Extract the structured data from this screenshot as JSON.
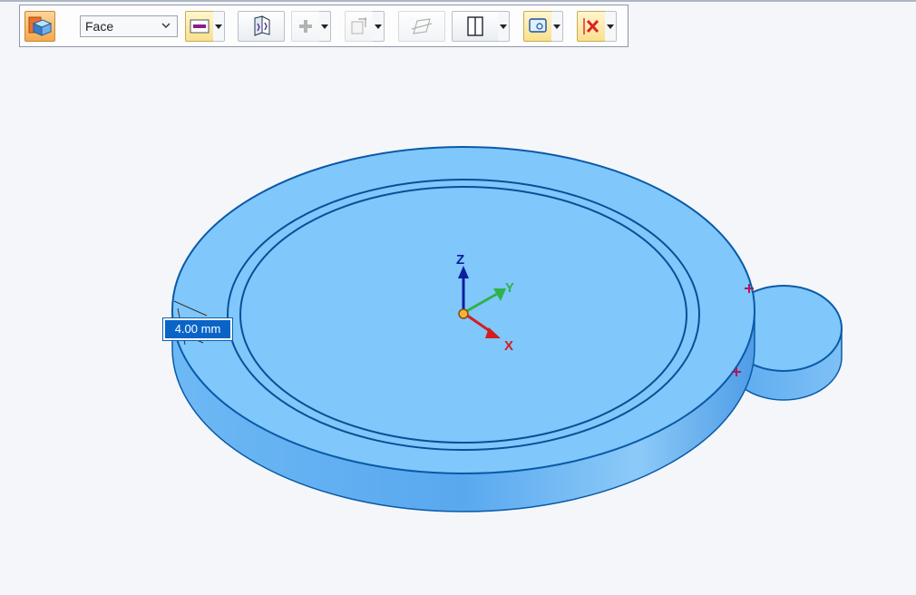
{
  "toolbar": {
    "selection_mode": "Face",
    "buttons": [
      {
        "name": "3d-view-button",
        "state": "active"
      },
      {
        "name": "color-swatch-button",
        "state": "normal"
      },
      {
        "name": "design-intent-button",
        "state": "normal"
      },
      {
        "name": "add-button",
        "state": "disabled"
      },
      {
        "name": "paste-button",
        "state": "disabled"
      },
      {
        "name": "plane-button",
        "state": "disabled"
      },
      {
        "name": "panel-button",
        "state": "normal"
      },
      {
        "name": "region-select-button",
        "state": "selected"
      },
      {
        "name": "delete-button",
        "state": "selected"
      }
    ]
  },
  "viewport": {
    "dimension_value": "4.00 mm",
    "axes": {
      "z": "Z",
      "y": "Y",
      "x": "X"
    },
    "colors": {
      "part_top": "#7ec6fb",
      "part_side": "#58a7ec",
      "edge": "#0a5aa8",
      "axis_z": "#0a1e9c",
      "axis_y": "#2fb24a",
      "axis_x": "#d41e1e"
    }
  }
}
